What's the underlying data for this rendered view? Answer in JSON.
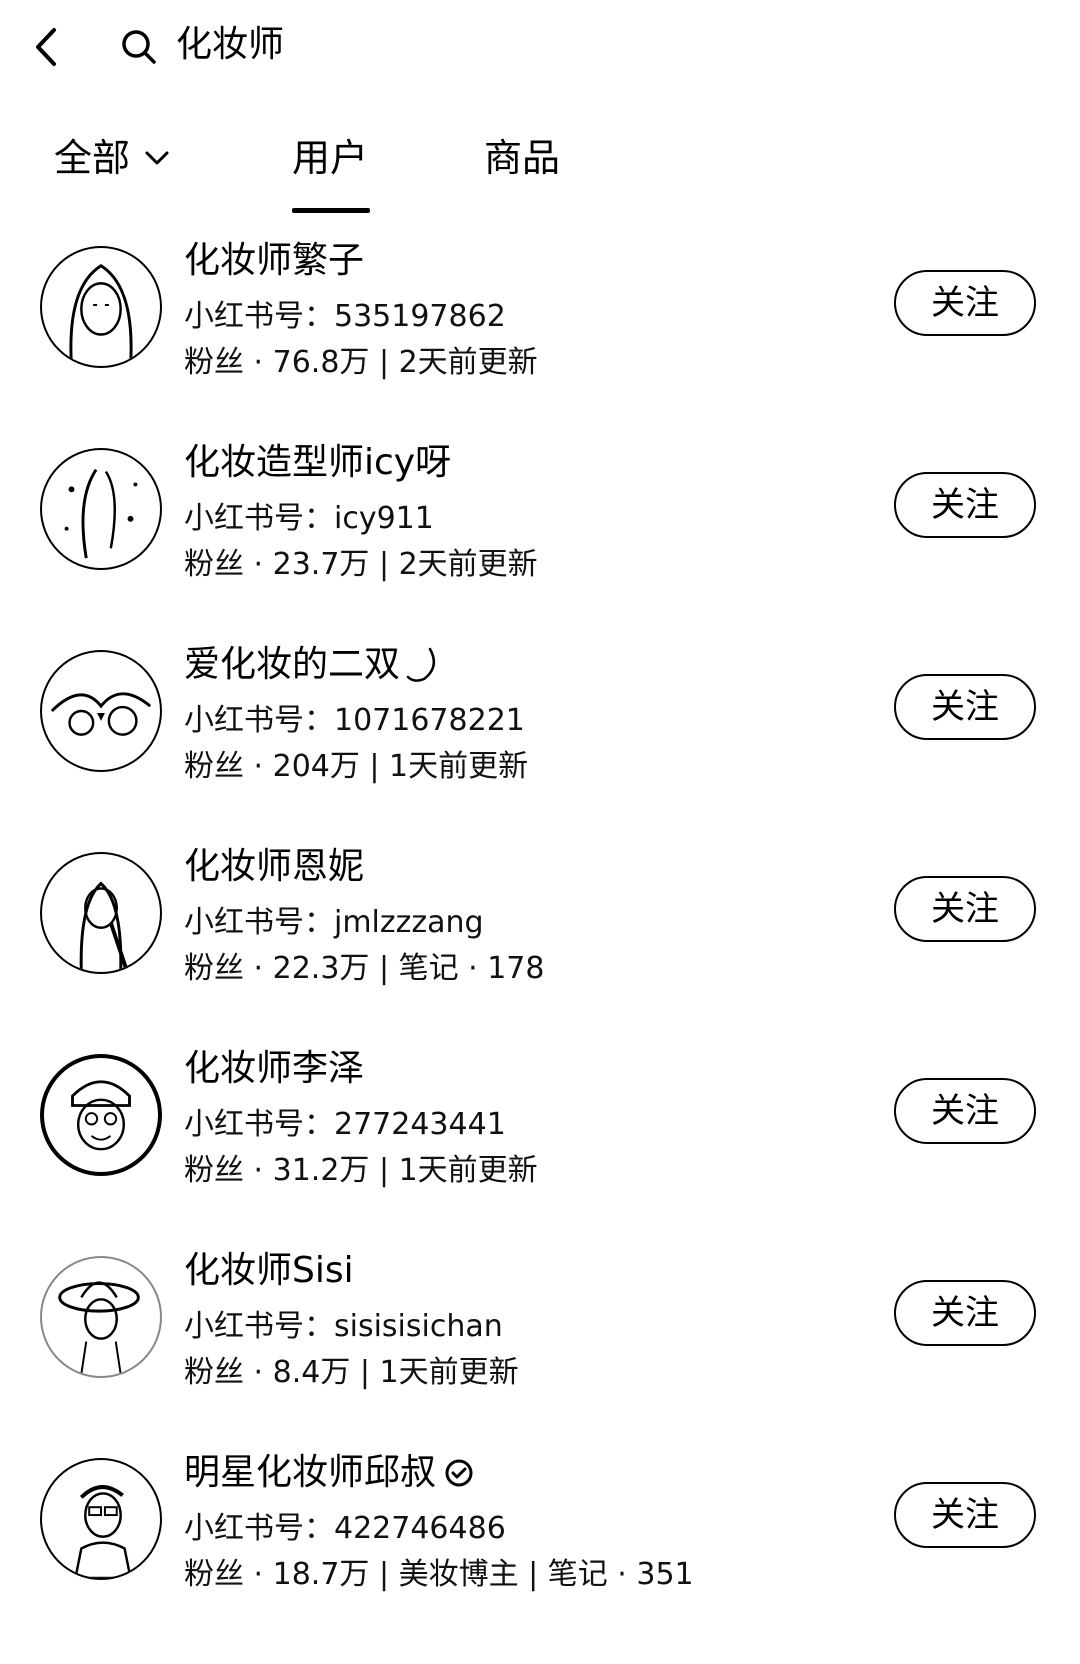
{
  "search": {
    "query": "化妆师"
  },
  "tabs": [
    {
      "label": "全部"
    },
    {
      "label": "用户"
    },
    {
      "label": "商品"
    }
  ],
  "users": [
    {
      "name": "化妆师繁子",
      "id_label": "小红书号：535197862",
      "meta": "粉丝 · 76.8万 | 2天前更新",
      "follow": "关注"
    },
    {
      "name": "化妆造型师icy呀",
      "id_label": "小红书号：icy911",
      "meta": "粉丝 · 23.7万 | 2天前更新",
      "follow": "关注"
    },
    {
      "name": "爱化妆的二双",
      "id_label": "小红书号：1071678221",
      "meta": "粉丝 · 204万 | 1天前更新",
      "follow": "关注"
    },
    {
      "name": "化妆师恩妮",
      "id_label": "小红书号：jmlzzzang",
      "meta": "粉丝 · 22.3万 | 笔记 · 178",
      "follow": "关注"
    },
    {
      "name": "化妆师李泽",
      "id_label": "小红书号：277243441",
      "meta": "粉丝 · 31.2万 | 1天前更新",
      "follow": "关注"
    },
    {
      "name": "化妆师Sisi",
      "id_label": "小红书号：sisisisichan",
      "meta": "粉丝 · 8.4万 | 1天前更新",
      "follow": "关注"
    },
    {
      "name": "明星化妆师邱叔",
      "id_label": "小红书号：422746486",
      "meta": "粉丝 · 18.7万 | 美妆博主 | 笔记 · 351",
      "follow": "关注"
    }
  ]
}
